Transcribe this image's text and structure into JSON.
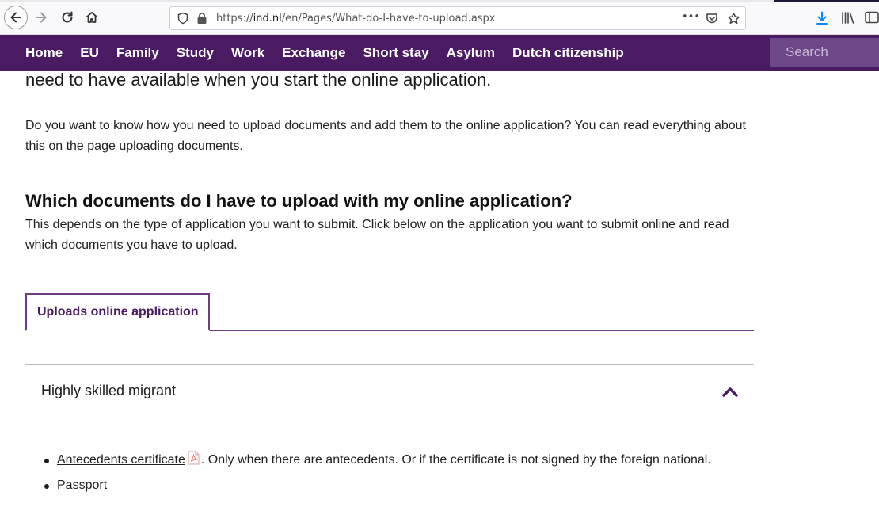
{
  "browser": {
    "url_prefix": "https://",
    "url_host": "ind.nl",
    "url_path": "/en/Pages/What-do-I-have-to-upload.aspx",
    "more_glyph": "•••"
  },
  "nav": {
    "items": [
      "Home",
      "EU",
      "Family",
      "Study",
      "Work",
      "Exchange",
      "Short stay",
      "Asylum",
      "Dutch citizenship"
    ],
    "search_placeholder": "Search"
  },
  "content": {
    "intro_tail": "need to have available when you start the online application.",
    "upload_question_1": "Do you want to know how you need to upload documents and add them to the online application? You can read everything about this on the page ",
    "upload_link": "uploading documents",
    "upload_question_2": ".",
    "heading": "Which documents do I have to upload with my online application?",
    "heading_desc": "This depends on the type of application you want to submit. Click below on the application you want to submit online and read which documents you have to upload.",
    "tab_label": "Uploads online application",
    "accordion_title": "Highly skilled migrant",
    "documents": [
      {
        "link": "Antecedents certificate",
        "text": ". Only when there are antecedents. Or if the certificate is not signed by the foreign national."
      },
      {
        "link": "",
        "text": "Passport"
      }
    ]
  },
  "colors": {
    "brand": "#4a1a63",
    "accent": "#6b3d85",
    "search_bg": "#6d4889"
  }
}
